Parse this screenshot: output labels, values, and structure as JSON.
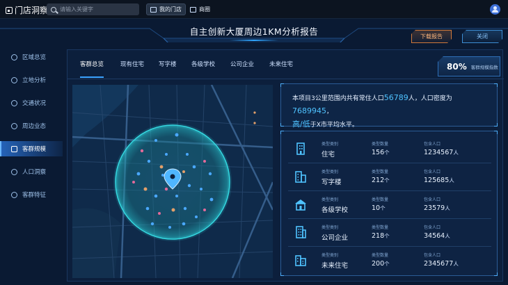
{
  "app": {
    "title": "门店洞察"
  },
  "search": {
    "placeholder": "请输入关键字"
  },
  "topnav": {
    "my_store": "我的门店",
    "business_circle": "商圈"
  },
  "header": {
    "title": "自主创新大厦周边1KM分析报告",
    "download_label": "下载报告",
    "close_label": "关闭"
  },
  "sidebar": {
    "items": [
      {
        "label": "区域总览",
        "icon": "area-icon"
      },
      {
        "label": "立地分析",
        "icon": "location-analysis-icon"
      },
      {
        "label": "交通状况",
        "icon": "traffic-icon"
      },
      {
        "label": "周边业态",
        "icon": "business-icon"
      },
      {
        "label": "客群规模",
        "icon": "customer-scale-icon",
        "active": true
      },
      {
        "label": "人口洞察",
        "icon": "population-icon"
      },
      {
        "label": "客群特征",
        "icon": "customer-feature-icon"
      }
    ]
  },
  "tabs": [
    {
      "label": "客群总览",
      "active": true
    },
    {
      "label": "现有住宅"
    },
    {
      "label": "写字楼"
    },
    {
      "label": "各级学校"
    },
    {
      "label": "公司企业"
    },
    {
      "label": "未来住宅"
    }
  ],
  "index": {
    "value": "80%",
    "label": "客群规模指数"
  },
  "summary": {
    "p1": "本项目3公里范围内共有常住人口",
    "population": "56789",
    "p2": "人，人口密度为",
    "density": "7689945",
    "p3": "，",
    "level": "高/低",
    "p4": "于X市平均水平。"
  },
  "type_headers": {
    "type": "类型类别",
    "count": "类型数量",
    "pop": "包含人口"
  },
  "types": [
    {
      "name": "住宅",
      "count": "156",
      "count_unit": "个",
      "pop": "1234567",
      "pop_unit": "人",
      "icon": "residence-icon"
    },
    {
      "name": "写字楼",
      "count": "212",
      "count_unit": "个",
      "pop": "125685",
      "pop_unit": "人",
      "icon": "office-building-icon"
    },
    {
      "name": "各级学校",
      "count": "10",
      "count_unit": "个",
      "pop": "23579",
      "pop_unit": "人",
      "icon": "school-icon"
    },
    {
      "name": "公司企业",
      "count": "218",
      "count_unit": "个",
      "pop": "34564",
      "pop_unit": "人",
      "icon": "company-icon"
    },
    {
      "name": "未来住宅",
      "count": "200",
      "count_unit": "个",
      "pop": "2345677",
      "pop_unit": "人",
      "icon": "future-residence-icon"
    }
  ],
  "colors": {
    "accent": "#4fc3ff",
    "active_bg": "#2563b8",
    "download": "#d27a3b"
  }
}
